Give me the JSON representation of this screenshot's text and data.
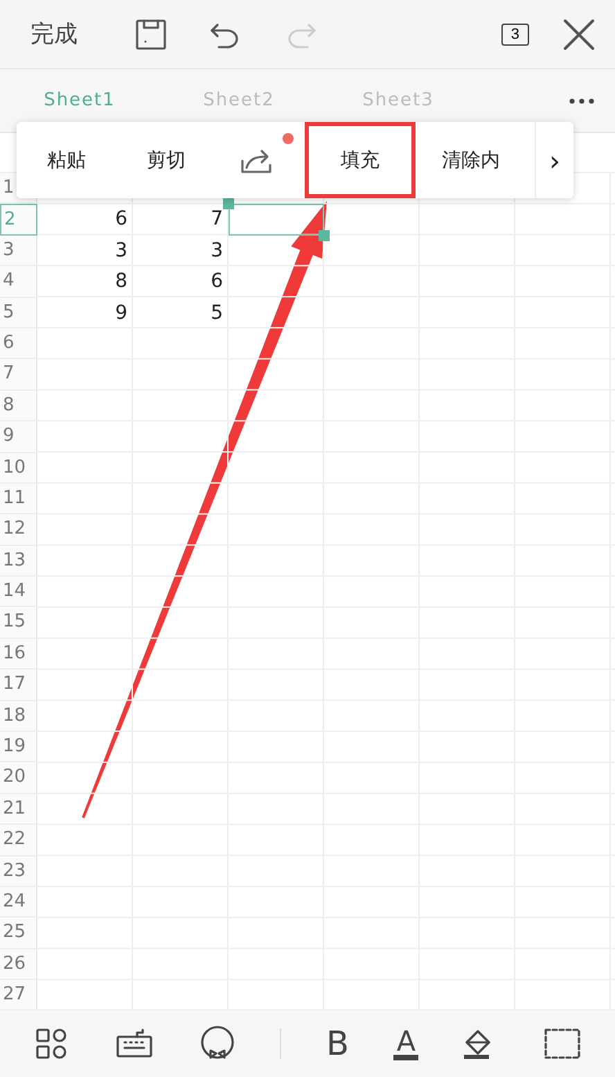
{
  "top_bar": {
    "done": "完成",
    "redo_disabled": true,
    "sheet_count": "3"
  },
  "tabs": [
    {
      "label": "Sheet1",
      "selected": true
    },
    {
      "label": "Sheet2",
      "selected": false
    },
    {
      "label": "Sheet3",
      "selected": false
    }
  ],
  "context_menu": {
    "items": [
      {
        "kind": "text",
        "label": "粘贴",
        "highlighted": false
      },
      {
        "kind": "text",
        "label": "剪切",
        "highlighted": false
      },
      {
        "kind": "share",
        "badge": true,
        "highlighted": false
      },
      {
        "kind": "text",
        "label": "填充",
        "highlighted": true
      },
      {
        "kind": "text",
        "label": "清除内",
        "highlighted": false
      },
      {
        "kind": "more",
        "label": "›",
        "highlighted": false
      }
    ]
  },
  "grid": {
    "rows": [
      {
        "label": "1",
        "selected": false
      },
      {
        "label": "2",
        "selected": true,
        "cells": [
          {
            "text": "6",
            "selected": false
          },
          {
            "text": "7",
            "selected": false
          },
          {
            "selected": true
          }
        ]
      },
      {
        "label": "3",
        "selected": false,
        "cells": [
          {
            "text": "3",
            "selected": false
          },
          {
            "text": "3",
            "selected": false
          }
        ]
      },
      {
        "label": "4",
        "selected": false,
        "cells": [
          {
            "text": "8",
            "selected": false
          },
          {
            "text": "6",
            "selected": false
          }
        ]
      },
      {
        "label": "5",
        "selected": false,
        "cells": [
          {
            "text": "9",
            "selected": false
          },
          {
            "text": "5",
            "selected": false
          }
        ]
      },
      {
        "label": "6",
        "selected": false
      },
      {
        "label": "7",
        "selected": false
      },
      {
        "label": "8",
        "selected": false
      },
      {
        "label": "9",
        "selected": false
      },
      {
        "label": "10",
        "selected": false
      },
      {
        "label": "11",
        "selected": false
      },
      {
        "label": "12",
        "selected": false
      },
      {
        "label": "13",
        "selected": false
      },
      {
        "label": "14",
        "selected": false
      },
      {
        "label": "15",
        "selected": false
      },
      {
        "label": "16",
        "selected": false
      },
      {
        "label": "17",
        "selected": false
      },
      {
        "label": "18",
        "selected": false
      },
      {
        "label": "19",
        "selected": false
      },
      {
        "label": "20",
        "selected": false
      },
      {
        "label": "21",
        "selected": false
      },
      {
        "label": "22",
        "selected": false
      },
      {
        "label": "23",
        "selected": false
      },
      {
        "label": "24",
        "selected": false
      },
      {
        "label": "25",
        "selected": false
      },
      {
        "label": "26",
        "selected": false
      },
      {
        "label": "27",
        "selected": false
      }
    ]
  },
  "annotation_arrow": true,
  "bottom_toolbar": [
    {
      "kind": "grid"
    },
    {
      "kind": "keyboard"
    },
    {
      "kind": "face"
    },
    {
      "kind": "divider"
    },
    {
      "kind": "bold",
      "label": "B"
    },
    {
      "kind": "font_color",
      "label": "A"
    },
    {
      "kind": "fill"
    },
    {
      "kind": "border"
    }
  ]
}
